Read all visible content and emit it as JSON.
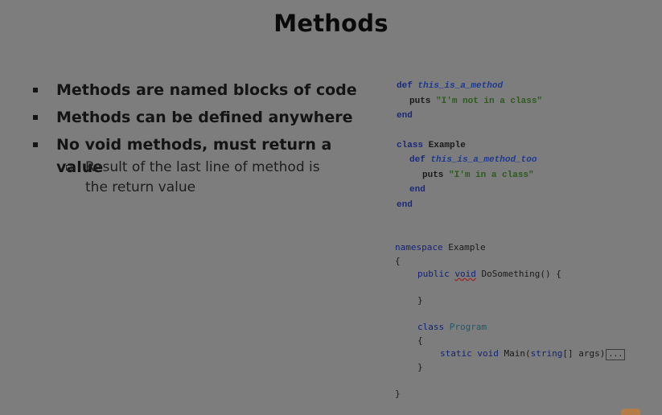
{
  "slide": {
    "title": "Methods",
    "bullets": [
      "Methods are named blocks of code",
      "Methods can be defined anywhere",
      "No void methods, must return a value"
    ],
    "sub_bullet": "Result of the last line of method is the return value"
  },
  "ruby_code": {
    "l1_kw": "def",
    "l1_name": "this_is_a_method",
    "l2_puts": "puts",
    "l2_str": "\"I'm not in a class\"",
    "l3": "end",
    "l5_kw": "class",
    "l5_name": "Example",
    "l6_kw": "def",
    "l6_name": "this_is_a_method_too",
    "l7_puts": "puts",
    "l7_str": "\"I'm in a class\"",
    "l8": "end",
    "l9": "end"
  },
  "csharp_code": {
    "ns_kw": "namespace",
    "ns_name": "Example",
    "open1": "{",
    "pub_kw": "public",
    "void_kw": "void",
    "method_sig": "DoSomething() {",
    "close_method": "}",
    "class_kw": "class",
    "class_name": "Program",
    "open2": "{",
    "static_kw": "static",
    "void2_kw": "void",
    "main_name": "Main(",
    "string_kw": "string",
    "args": "[] args)",
    "fold": "...",
    "close2": "}",
    "close1": "}"
  }
}
